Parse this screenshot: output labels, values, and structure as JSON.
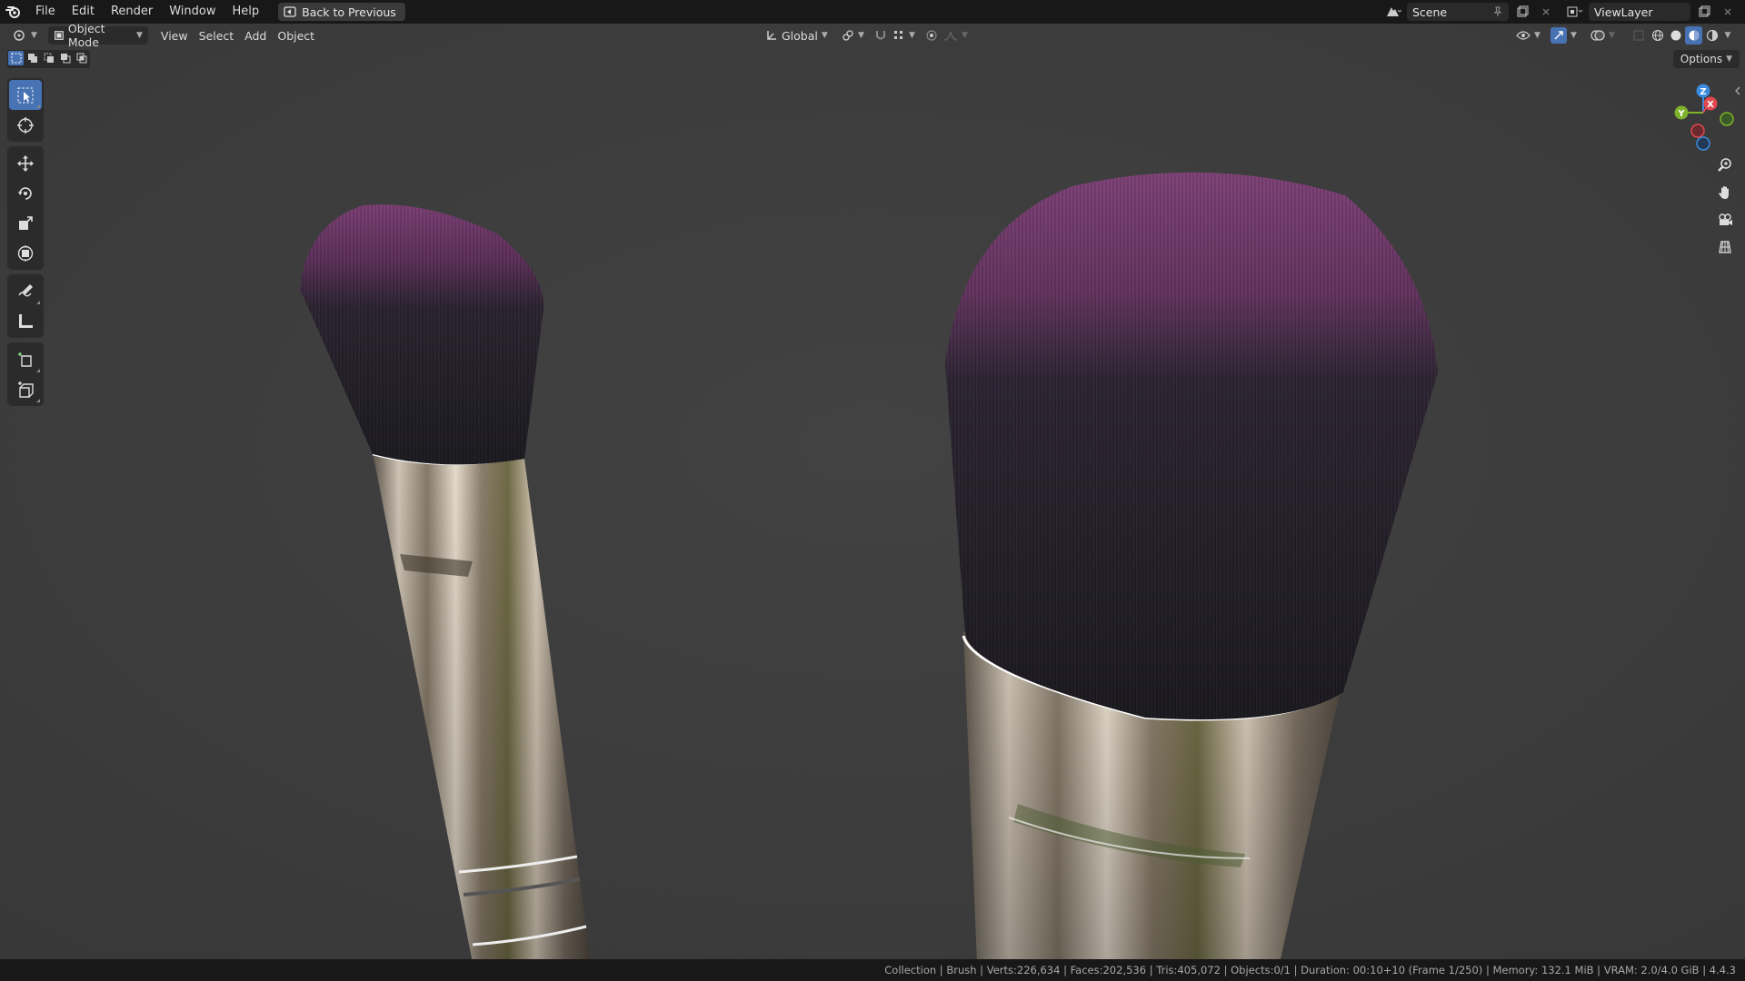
{
  "menus": [
    "File",
    "Edit",
    "Render",
    "Window",
    "Help"
  ],
  "back_button": "Back to Previous",
  "scene_name": "Scene",
  "view_layer": "ViewLayer",
  "header": {
    "mode": "Object Mode",
    "menus": [
      "View",
      "Select",
      "Add",
      "Object"
    ],
    "orientation": "Global"
  },
  "options_label": "Options",
  "gizmo": {
    "z": "Z",
    "y": "Y",
    "x": "X"
  },
  "status": {
    "collection": "Collection",
    "object": "Brush",
    "verts": "Verts:226,634",
    "faces": "Faces:202,536",
    "tris": "Tris:405,072",
    "objects": "Objects:0/1",
    "duration": "Duration: 00:10+10 (Frame 1/250)",
    "memory": "Memory: 132.1 MiB",
    "vram": "VRAM: 2.0/4.0 GiB",
    "version": "4.4.3"
  },
  "colors": {
    "accent": "#4772b3",
    "viewport_bg": "#3c3c3c",
    "bristle_tip": "#7a3f72",
    "bristle_base": "#1c1b20",
    "axis_x": "#e0474f",
    "axis_y": "#7fb22b",
    "axis_z": "#3b8ce0"
  }
}
